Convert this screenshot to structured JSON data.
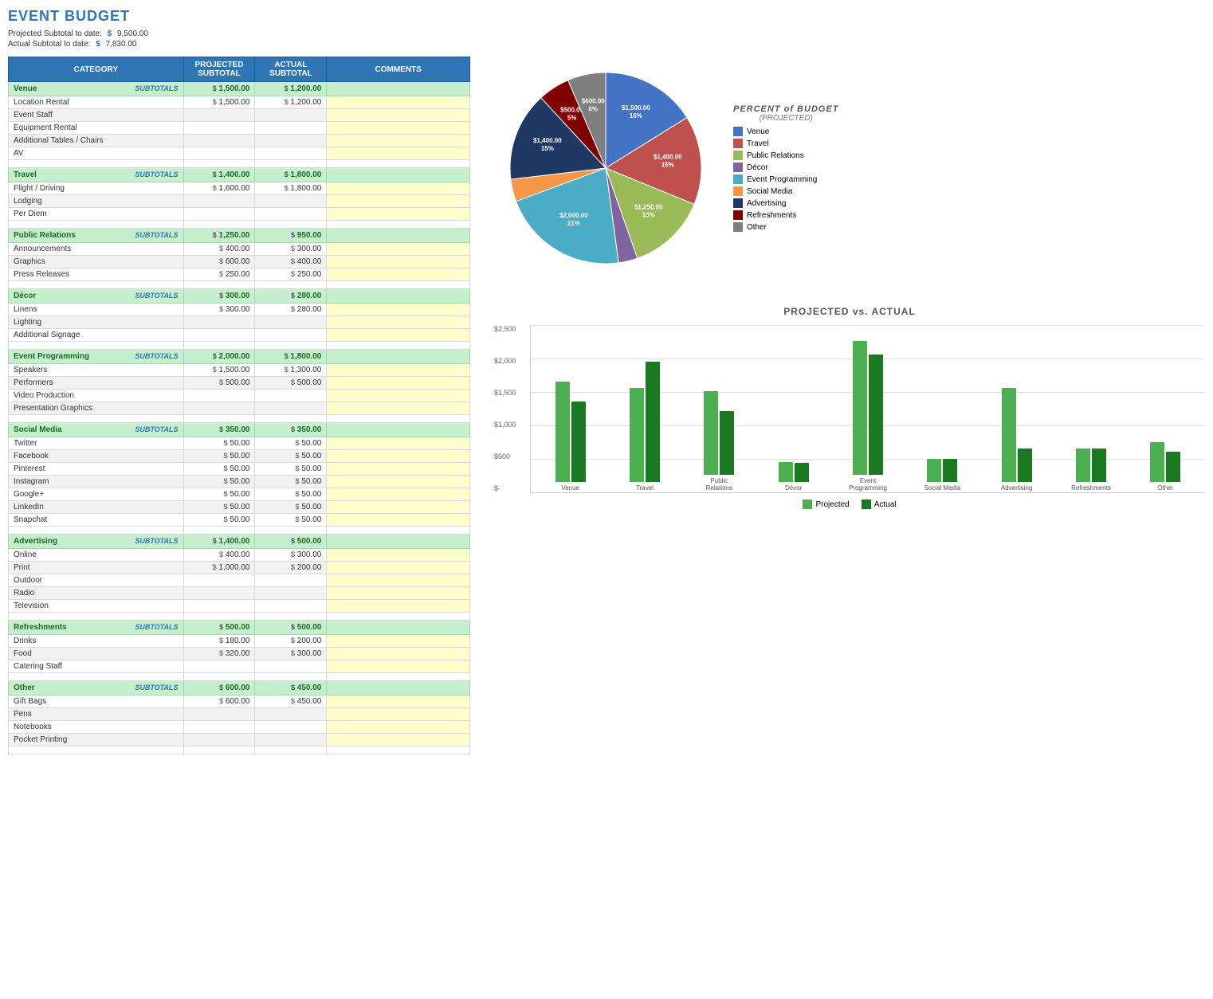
{
  "title": "EVENT BUDGET",
  "projected_subtotal_label": "Projected Subtotal to date:",
  "actual_subtotal_label": "Actual Subtotal to date:",
  "projected_subtotal_value": "9,500.00",
  "actual_subtotal_value": "7,830.00",
  "table": {
    "headers": [
      "CATEGORY",
      "PROJECTED SUBTOTAL",
      "ACTUAL SUBTOTAL",
      "COMMENTS"
    ],
    "sections": [
      {
        "name": "Venue",
        "projected": "1,500.00",
        "actual": "1,200.00",
        "items": [
          {
            "name": "Location Rental",
            "projected": "1,500.00",
            "actual": "1,200.00"
          },
          {
            "name": "Event Staff",
            "projected": "",
            "actual": ""
          },
          {
            "name": "Equipment Rental",
            "projected": "",
            "actual": ""
          },
          {
            "name": "Additional Tables / Chairs",
            "projected": "",
            "actual": ""
          },
          {
            "name": "AV",
            "projected": "",
            "actual": ""
          }
        ]
      },
      {
        "name": "Travel",
        "projected": "1,400.00",
        "actual": "1,800.00",
        "items": [
          {
            "name": "Flight / Driving",
            "projected": "1,600.00",
            "actual": "1,800.00"
          },
          {
            "name": "Lodging",
            "projected": "",
            "actual": ""
          },
          {
            "name": "Per Diem",
            "projected": "",
            "actual": ""
          }
        ]
      },
      {
        "name": "Public Relations",
        "projected": "1,250.00",
        "actual": "950.00",
        "items": [
          {
            "name": "Announcements",
            "projected": "400.00",
            "actual": "300.00"
          },
          {
            "name": "Graphics",
            "projected": "600.00",
            "actual": "400.00"
          },
          {
            "name": "Press Releases",
            "projected": "250.00",
            "actual": "250.00"
          }
        ]
      },
      {
        "name": "Décor",
        "projected": "300.00",
        "actual": "280.00",
        "items": [
          {
            "name": "Linens",
            "projected": "300.00",
            "actual": "280.00"
          },
          {
            "name": "Lighting",
            "projected": "",
            "actual": ""
          },
          {
            "name": "Additional Signage",
            "projected": "",
            "actual": ""
          }
        ]
      },
      {
        "name": "Event Programming",
        "projected": "2,000.00",
        "actual": "1,800.00",
        "items": [
          {
            "name": "Speakers",
            "projected": "1,500.00",
            "actual": "1,300.00"
          },
          {
            "name": "Performers",
            "projected": "500.00",
            "actual": "500.00"
          },
          {
            "name": "Video Production",
            "projected": "",
            "actual": ""
          },
          {
            "name": "Presentation Graphics",
            "projected": "",
            "actual": ""
          }
        ]
      },
      {
        "name": "Social Media",
        "projected": "350.00",
        "actual": "350.00",
        "items": [
          {
            "name": "Twitter",
            "projected": "50.00",
            "actual": "50.00"
          },
          {
            "name": "Facebook",
            "projected": "50.00",
            "actual": "50.00"
          },
          {
            "name": "Pinterest",
            "projected": "50.00",
            "actual": "50.00"
          },
          {
            "name": "Instagram",
            "projected": "50.00",
            "actual": "50.00"
          },
          {
            "name": "Google+",
            "projected": "50.00",
            "actual": "50.00"
          },
          {
            "name": "LinkedIn",
            "projected": "50.00",
            "actual": "50.00"
          },
          {
            "name": "Snapchat",
            "projected": "50.00",
            "actual": "50.00"
          }
        ]
      },
      {
        "name": "Advertising",
        "projected": "1,400.00",
        "actual": "500.00",
        "items": [
          {
            "name": "Online",
            "projected": "400.00",
            "actual": "300.00"
          },
          {
            "name": "Print",
            "projected": "1,000.00",
            "actual": "200.00"
          },
          {
            "name": "Outdoor",
            "projected": "",
            "actual": ""
          },
          {
            "name": "Radio",
            "projected": "",
            "actual": ""
          },
          {
            "name": "Television",
            "projected": "",
            "actual": ""
          }
        ]
      },
      {
        "name": "Refreshments",
        "projected": "500.00",
        "actual": "500.00",
        "items": [
          {
            "name": "Drinks",
            "projected": "180.00",
            "actual": "200.00"
          },
          {
            "name": "Food",
            "projected": "320.00",
            "actual": "300.00"
          },
          {
            "name": "Catering Staff",
            "projected": "",
            "actual": ""
          }
        ]
      },
      {
        "name": "Other",
        "projected": "600.00",
        "actual": "450.00",
        "items": [
          {
            "name": "Gift Bags",
            "projected": "600.00",
            "actual": "450.00"
          },
          {
            "name": "Pens",
            "projected": "",
            "actual": ""
          },
          {
            "name": "Notebooks",
            "projected": "",
            "actual": ""
          },
          {
            "name": "Pocket Printing",
            "projected": "",
            "actual": ""
          }
        ]
      }
    ]
  },
  "pie_chart": {
    "title": "PERCENT of BUDGET",
    "subtitle": "(PROJECTED)",
    "segments": [
      {
        "label": "Venue",
        "value": 1500,
        "percent": 16,
        "color": "#4472c4",
        "angle_start": 0,
        "angle_end": 57.6
      },
      {
        "label": "Travel",
        "value": 1400,
        "percent": 15,
        "color": "#c0504d",
        "angle_start": 57.6,
        "angle_end": 111.6
      },
      {
        "label": "Public Relations",
        "value": 1250,
        "percent": 13,
        "color": "#9bbb59",
        "angle_start": 111.6,
        "angle_end": 158.4
      },
      {
        "label": "Décor",
        "value": 300,
        "percent": 3,
        "color": "#8064a2",
        "angle_start": 158.4,
        "angle_end": 169.2
      },
      {
        "label": "Event Programming",
        "value": 2000,
        "percent": 21,
        "color": "#4bacc6",
        "angle_start": 169.2,
        "angle_end": 244.8
      },
      {
        "label": "Social Media",
        "value": 350,
        "percent": 4,
        "color": "#f79646",
        "angle_start": 244.8,
        "angle_end": 257.4
      },
      {
        "label": "Advertising",
        "value": 1400,
        "percent": 15,
        "color": "#1f3864",
        "angle_start": 257.4,
        "angle_end": 311.4
      },
      {
        "label": "Refreshments",
        "value": 500,
        "percent": 5,
        "color": "#7f0000",
        "angle_start": 311.4,
        "angle_end": 329.4
      },
      {
        "label": "Other",
        "value": 600,
        "percent": 6,
        "color": "#7f7f7f",
        "angle_start": 329.4,
        "angle_end": 360
      }
    ]
  },
  "bar_chart": {
    "title": "PROJECTED vs. ACTUAL",
    "y_labels": [
      "$2,500",
      "$2,000",
      "$1,500",
      "$1,000",
      "$500",
      "$-"
    ],
    "groups": [
      {
        "label": "Venue",
        "projected": 1500,
        "actual": 1200
      },
      {
        "label": "Travel",
        "projected": 1400,
        "actual": 1800
      },
      {
        "label": "Public Relations",
        "projected": 1250,
        "actual": 950
      },
      {
        "label": "Décor",
        "projected": 300,
        "actual": 280
      },
      {
        "label": "Event Programming",
        "projected": 2000,
        "actual": 1800
      },
      {
        "label": "Social Media",
        "projected": 350,
        "actual": 350
      },
      {
        "label": "Advertising",
        "projected": 1400,
        "actual": 500
      },
      {
        "label": "Refreshments",
        "projected": 500,
        "actual": 500
      },
      {
        "label": "Other",
        "projected": 600,
        "actual": 450
      }
    ],
    "legend": {
      "projected_label": "Projected",
      "actual_label": "Actual"
    }
  }
}
